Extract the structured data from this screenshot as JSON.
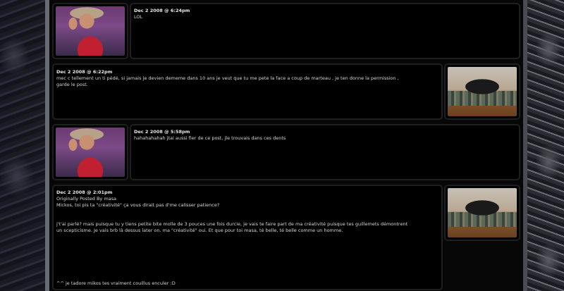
{
  "posts": [
    {
      "date": "Dec 2 2008 @ 6:24pm",
      "lines": [
        "LOL"
      ]
    },
    {
      "date": "Dec 2 2008 @ 6:22pm",
      "lines": [
        "mec c tellement un ti pédé, si jamais je devien dememe dans 10 ans je veut que tu me pete la face a coup de marteau , je ten donne la permission ,",
        "garde le post."
      ]
    },
    {
      "date": "Dec 2 2008 @ 5:58pm",
      "lines": [
        "hahahahahah jtai aussi fier de ce post, jle trouvais dans ces dents"
      ]
    },
    {
      "date": "Dec 2 2008 @ 2:01pm",
      "quote_header": "Originally Posted By masa",
      "quote_text": "Mickos, toi pis ta \"créativité\" ça vous dirait pas d'me calisser patience?",
      "body_lines": [
        "j't'ai parlé? mais puisque tu y tiens petite bite molle de 3 pouces une fois durcie, je vais te faire part de ma créativité puisque tes guillemets démontrent",
        "un scepticisme. Je vais brb là dessus later on. ma \"créativité\" oui. Et que pour toi masa, té belle, té belle comme un homme."
      ],
      "footer": "^^ je tadore mikos tes vraiment couillus enculer :D"
    }
  ],
  "avatars": {
    "person": "avatar-person-image",
    "room": "avatar-room-image"
  }
}
